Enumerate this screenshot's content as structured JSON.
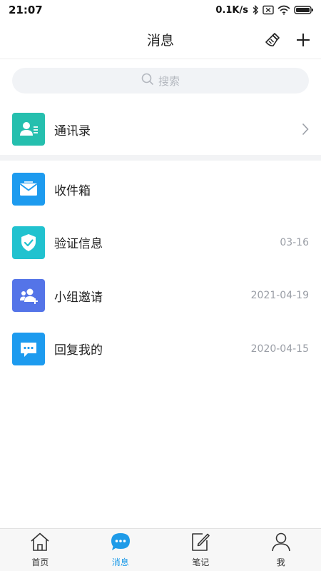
{
  "status_bar": {
    "time": "21:07",
    "speed": "0.1K/s"
  },
  "header": {
    "title": "消息",
    "clear_icon": "broom-icon",
    "add_icon": "plus-icon"
  },
  "search": {
    "placeholder": "搜索"
  },
  "contacts": {
    "label": "通讯录",
    "icon": "contact-card-icon",
    "color": "#25bfae"
  },
  "messages": [
    {
      "label": "收件箱",
      "date": "",
      "icon": "envelope-icon",
      "color": "#1d9bef"
    },
    {
      "label": "验证信息",
      "date": "03-16",
      "icon": "shield-check-icon",
      "color": "#21c2cf"
    },
    {
      "label": "小组邀请",
      "date": "2021-04-19",
      "icon": "group-add-icon",
      "color": "#5474e8"
    },
    {
      "label": "回复我的",
      "date": "2020-04-15",
      "icon": "chat-bubble-icon",
      "color": "#1d9bef"
    }
  ],
  "tabs": [
    {
      "label": "首页",
      "icon": "home-icon",
      "active": false
    },
    {
      "label": "消息",
      "icon": "message-icon",
      "active": true
    },
    {
      "label": "笔记",
      "icon": "note-edit-icon",
      "active": false
    },
    {
      "label": "我",
      "icon": "person-icon",
      "active": false
    }
  ],
  "colors": {
    "accent": "#1e9be8",
    "muted": "#9a9ea6"
  }
}
